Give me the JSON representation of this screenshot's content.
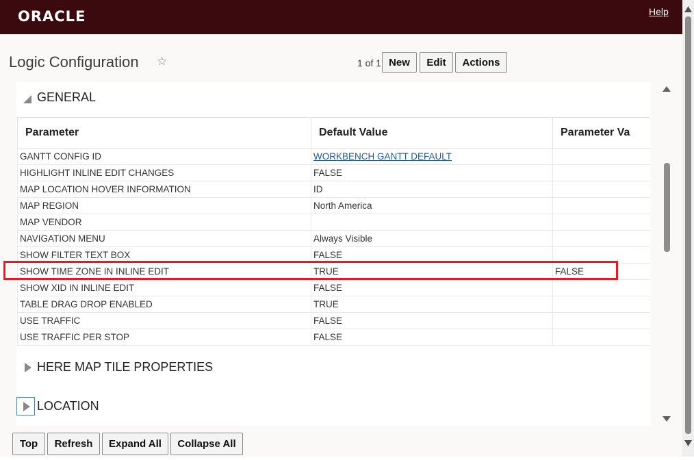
{
  "header": {
    "logo": "ORACLE",
    "help": "Help"
  },
  "page": {
    "title": "Logic Configuration",
    "star_icon": "star-outline-icon"
  },
  "toolbar": {
    "pager": "1 of 1",
    "new": "New",
    "edit": "Edit",
    "actions": "Actions"
  },
  "sections": {
    "general": {
      "label": "GENERAL",
      "state": "expanded"
    },
    "here_map": {
      "label": "HERE MAP TILE PROPERTIES",
      "state": "collapsed"
    },
    "location": {
      "label": "LOCATION",
      "state": "collapsed"
    }
  },
  "table": {
    "columns": [
      "Parameter",
      "Default Value",
      "Parameter Va"
    ],
    "rows": [
      {
        "param": "GANTT CONFIG ID",
        "default": "WORKBENCH GANTT DEFAULT",
        "value": "",
        "default_is_link": true
      },
      {
        "param": "HIGHLIGHT INLINE EDIT CHANGES",
        "default": "FALSE",
        "value": ""
      },
      {
        "param": "MAP LOCATION HOVER INFORMATION",
        "default": "ID",
        "value": ""
      },
      {
        "param": "MAP REGION",
        "default": "North America",
        "value": ""
      },
      {
        "param": "MAP VENDOR",
        "default": "",
        "value": ""
      },
      {
        "param": "NAVIGATION MENU",
        "default": "Always Visible",
        "value": ""
      },
      {
        "param": "SHOW FILTER TEXT BOX",
        "default": "FALSE",
        "value": ""
      },
      {
        "param": "SHOW TIME ZONE IN INLINE EDIT",
        "default": "TRUE",
        "value": "FALSE",
        "highlighted": true
      },
      {
        "param": "SHOW XID IN INLINE EDIT",
        "default": "FALSE",
        "value": ""
      },
      {
        "param": "TABLE DRAG DROP ENABLED",
        "default": "TRUE",
        "value": ""
      },
      {
        "param": "USE TRAFFIC",
        "default": "FALSE",
        "value": ""
      },
      {
        "param": "USE TRAFFIC PER STOP",
        "default": "FALSE",
        "value": ""
      }
    ]
  },
  "bottom_toolbar": {
    "top": "Top",
    "refresh": "Refresh",
    "expand_all": "Expand All",
    "collapse_all": "Collapse All"
  },
  "colors": {
    "header_bg": "#3a0a0e",
    "highlight_border": "#e31b23",
    "link": "#1f5a9b"
  }
}
